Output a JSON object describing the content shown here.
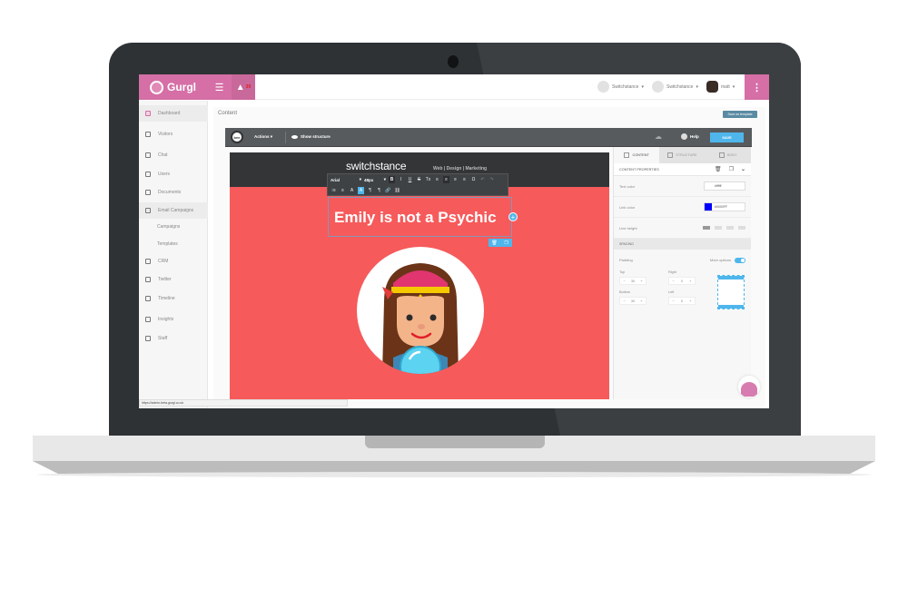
{
  "app": {
    "brand": "Gurgl",
    "notification_count": "39"
  },
  "topbar": {
    "users": [
      {
        "name": "Switchstance"
      },
      {
        "name": "Switchstance"
      },
      {
        "name": "matt"
      }
    ],
    "caret": "▾",
    "menu_icon": "☰",
    "bell_icon": "🔔",
    "kebab_icon": "⋮"
  },
  "sidebar": {
    "items": [
      {
        "label": "Dashboard"
      },
      {
        "label": "Visitors"
      },
      {
        "label": "Chat"
      },
      {
        "label": "Users"
      },
      {
        "label": "Documents"
      },
      {
        "label": "Email Campaigns"
      },
      {
        "label": "Campaigns"
      },
      {
        "label": "Templates"
      },
      {
        "label": "CRM"
      },
      {
        "label": "Twitter"
      },
      {
        "label": "Timeline"
      },
      {
        "label": "Insights"
      },
      {
        "label": "Staff"
      }
    ]
  },
  "content": {
    "title": "Content",
    "save_template_label": "Save as template"
  },
  "editor": {
    "logo_text": "bee",
    "actions_label": "Actions ▾",
    "show_structure_label": "Show structure",
    "help_label": "Help",
    "save_label": "SAVE",
    "cloud_icon": "☁"
  },
  "email": {
    "logo_word": "switchstance",
    "logo_tagline": "Web | Design | Marketing",
    "headline": "Emily is not a Psychic",
    "add_icon": "+",
    "delete_icon": "🗑",
    "duplicate_icon": "❐"
  },
  "text_toolbar": {
    "font": "Arial",
    "size": "48px",
    "row1_buttons": [
      "B",
      "I",
      "U",
      "S",
      "Tx",
      "≡",
      "≡",
      "≡",
      "≡",
      "Ω",
      "↶",
      "↷"
    ],
    "row2_buttons": [
      "⁝≡",
      "≡",
      "A",
      "A",
      "¶",
      "¶",
      "🔗",
      "⛓"
    ]
  },
  "properties": {
    "tabs": [
      {
        "label": "CONTENT"
      },
      {
        "label": "STRUCTURE"
      },
      {
        "label": "BODY"
      }
    ],
    "section_title": "CONTENT PROPERTIES",
    "text_color_label": "Text color",
    "text_color_value": "#ffffff",
    "link_color_label": "Link color",
    "link_color_value": "#0000FF",
    "line_height_label": "Line height",
    "spacing_label": "SPACING",
    "padding_label": "Padding",
    "more_options_label": "More options",
    "more_options_on": true,
    "padding": {
      "top_label": "Top",
      "top_value": "30",
      "right_label": "Right",
      "right_value": "0",
      "bottom_label": "Bottom",
      "bottom_value": "30",
      "left_label": "Left",
      "left_value": "0"
    },
    "minus": "−",
    "plus": "+"
  },
  "statusbar": {
    "url": "https://admin-beta.gurgl.co.uk"
  },
  "colors": {
    "brand": "#d56fa6",
    "canvas_bg": "#f65a5b",
    "accent": "#4fb6ec",
    "link_color": "#0000FF"
  }
}
